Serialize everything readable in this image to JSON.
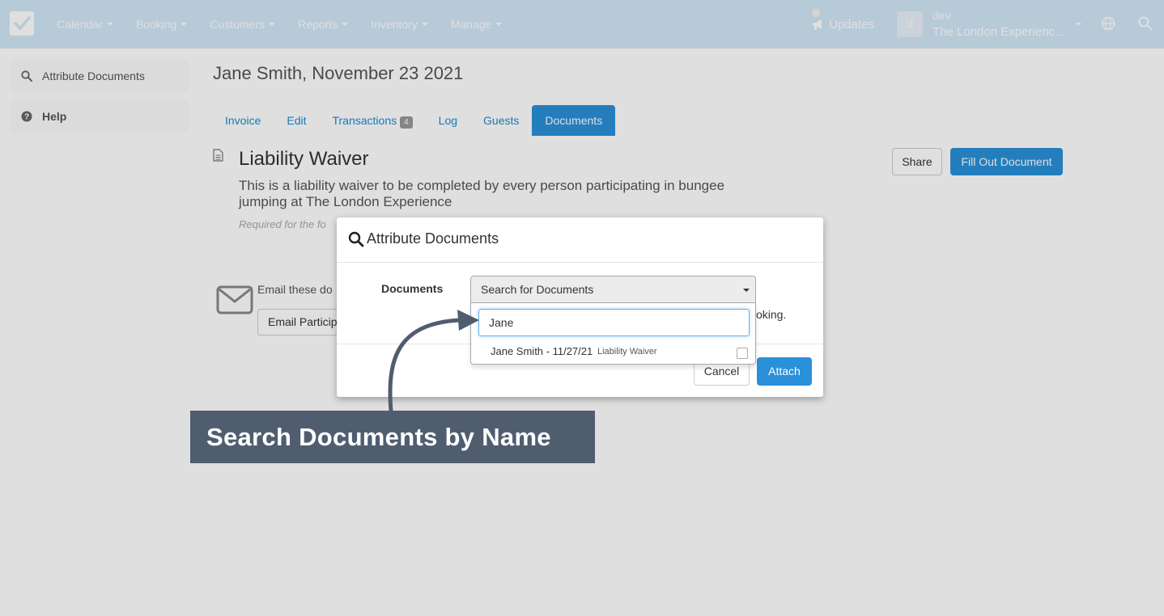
{
  "navbar": {
    "menu": [
      {
        "label": "Calendar"
      },
      {
        "label": "Booking"
      },
      {
        "label": "Customers"
      },
      {
        "label": "Reports"
      },
      {
        "label": "Inventory"
      },
      {
        "label": "Manage"
      }
    ],
    "updates_label": "Updates",
    "user_initial": "d",
    "user_name": "dev",
    "company": "The London Experienc..."
  },
  "sidebar": {
    "items": [
      {
        "label": "Attribute Documents",
        "icon": "search-icon"
      },
      {
        "label": "Help",
        "icon": "question-circle-icon"
      }
    ]
  },
  "page": {
    "title": "Jane Smith, November 23 2021",
    "tabs": [
      {
        "label": "Invoice"
      },
      {
        "label": "Edit"
      },
      {
        "label": "Transactions",
        "badge": "4"
      },
      {
        "label": "Log"
      },
      {
        "label": "Guests"
      },
      {
        "label": "Documents"
      }
    ],
    "active_tab": "Documents"
  },
  "document": {
    "title": "Liability Waiver",
    "description": "This is a liability waiver to be completed by every person participating in bungee jumping at The London Experience",
    "required_note": "Required for the fo",
    "share_label": "Share",
    "fill_label": "Fill Out Document",
    "email_text": "Email these do",
    "email_button_label": "Email Particip"
  },
  "modal": {
    "title": "Attribute Documents",
    "field_label": "Documents",
    "select_placeholder": "Search for Documents",
    "partial_text": "oking.",
    "cancel_label": "Cancel",
    "attach_label": "Attach"
  },
  "dropdown": {
    "search_value": "Jane",
    "options": [
      {
        "name": "Jane Smith - 11/27/21",
        "type": "Liability Waiver"
      }
    ]
  },
  "annotation": {
    "text": "Search Documents by Name"
  },
  "colors": {
    "navbar": "#d2e7f7",
    "primary": "#2a90d9",
    "callout": "#4f5d6f",
    "backdrop": "rgba(0,0,0,0.125)"
  }
}
